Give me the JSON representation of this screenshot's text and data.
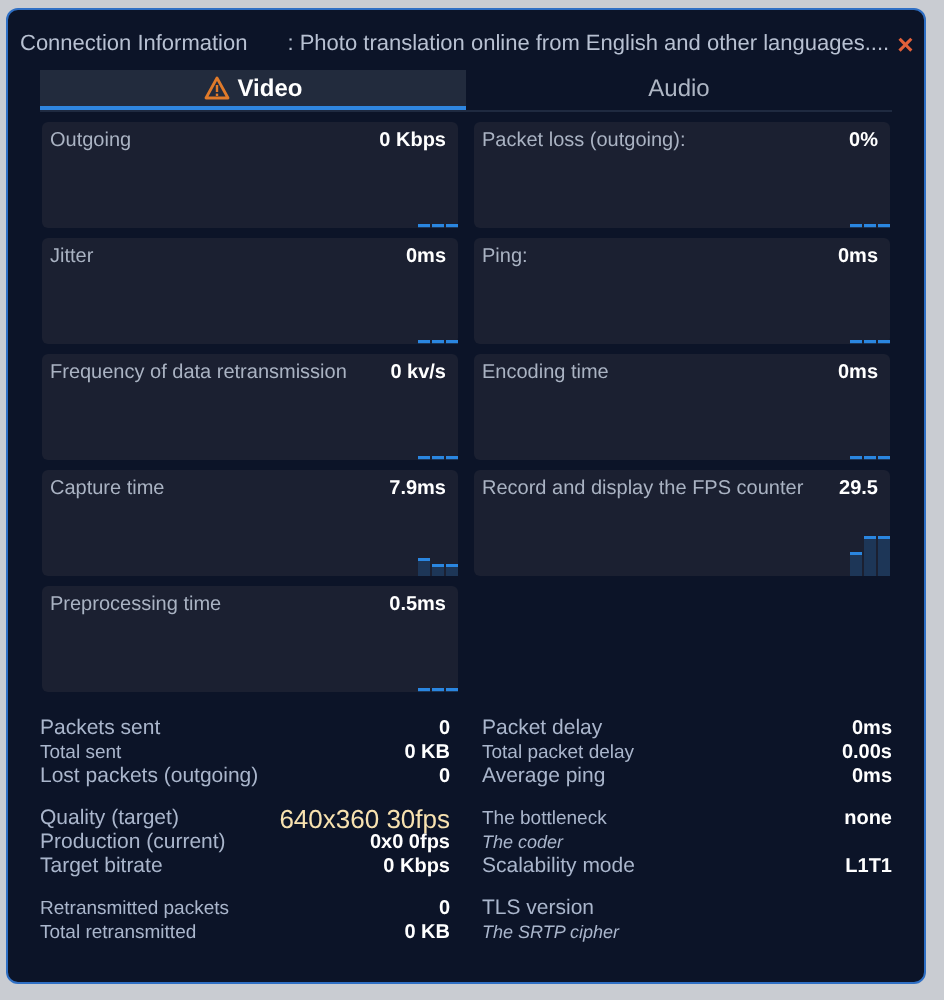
{
  "window": {
    "title": "Connection Information",
    "subtitle": ": Photo translation online from English and other languages....",
    "close": "×"
  },
  "tabs": [
    {
      "label": "Video",
      "selected": true,
      "warning": true
    },
    {
      "label": "Audio",
      "selected": false,
      "warning": false
    }
  ],
  "cards": [
    {
      "label": "Outgoing",
      "value": "0 Kbps",
      "kind": "flat"
    },
    {
      "label": "Packet loss (outgoing):",
      "value": "0%",
      "kind": "flat"
    },
    {
      "label": "Jitter",
      "value": "0ms",
      "kind": "flat"
    },
    {
      "label": "Ping:",
      "value": "0ms",
      "kind": "flat"
    },
    {
      "label": "Frequency of data retransmission",
      "value": "0 kv/s",
      "kind": "flat"
    },
    {
      "label": "Encoding time",
      "value": "0ms",
      "kind": "flat"
    },
    {
      "label": "Capture time",
      "value": "7.9ms",
      "kind": "low"
    },
    {
      "label": "Record and display the FPS counter",
      "value": "29.5",
      "kind": "high"
    },
    {
      "label": "Preprocessing time",
      "value": "0.5ms",
      "kind": "flat"
    }
  ],
  "stat_groups": [
    {
      "left": [
        {
          "label": "Packets sent",
          "value": "0",
          "kind": "main"
        },
        {
          "label": "Total sent",
          "value": "0 KB",
          "kind": "sub"
        },
        {
          "label": "Lost packets (outgoing)",
          "value": "0",
          "kind": "main"
        }
      ],
      "right": [
        {
          "label": "Packet delay",
          "value": "0ms",
          "kind": "main"
        },
        {
          "label": "Total packet delay",
          "value": "0.00s",
          "kind": "sub"
        },
        {
          "label": "Average ping",
          "value": "0ms",
          "kind": "main"
        }
      ]
    },
    {
      "left": [
        {
          "label": "Quality (target)",
          "value": "640x360 30fps",
          "kind": "highlight"
        },
        {
          "label": "Production (current)",
          "value": "0x0 0fps",
          "kind": "main"
        },
        {
          "label": "Target bitrate",
          "value": "0 Kbps",
          "kind": "main"
        }
      ],
      "right": [
        {
          "label": "The bottleneck",
          "value": "none",
          "kind": "sub"
        },
        {
          "label": "The coder",
          "kind": "note"
        },
        {
          "label": "Scalability mode",
          "value": "L1T1",
          "kind": "main"
        }
      ]
    },
    {
      "left": [
        {
          "label": "Retransmitted packets",
          "value": "0",
          "kind": "sub"
        },
        {
          "label": "Total retransmitted",
          "value": "0 KB",
          "kind": "sub"
        }
      ],
      "right": [
        {
          "label": "TLS version",
          "kind": "main"
        },
        {
          "label": "The SRTP cipher",
          "kind": "note"
        }
      ]
    }
  ]
}
